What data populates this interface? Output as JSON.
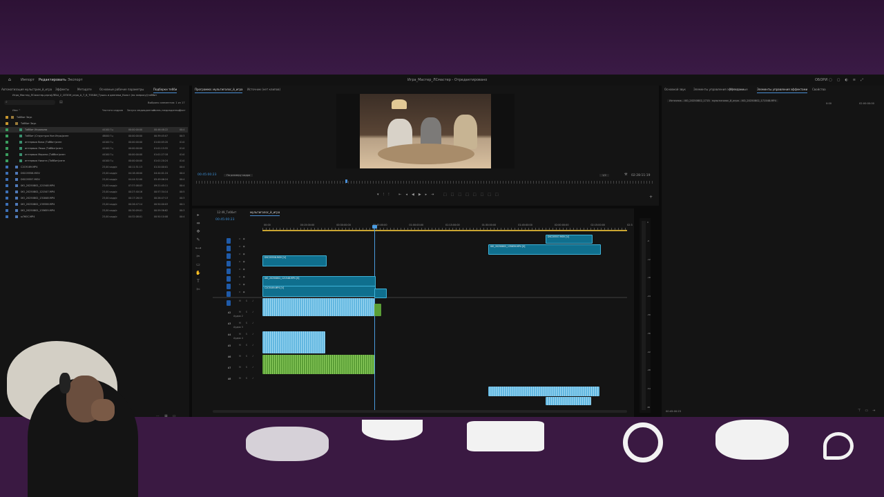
{
  "colors": {
    "accent": "#4a8fd6",
    "video_clip": "#0f6f8e",
    "audio_clip": "#62b7e0",
    "audio_clip_green": "#5a9e36",
    "track_toggle": "#1f5aa8"
  },
  "menubar": {
    "items": [
      "Импорт",
      "Редактировать",
      "Экспорт"
    ],
    "title": "Игра_Мастер_ЛСмастер - Отредактировано",
    "right": "ОБОРИ"
  },
  "project": {
    "tabs": [
      "Автоматизация мульстрим_й_игра",
      "Эффекты",
      "Метадате",
      "Основные рабочие параметры",
      "Подборки тебби"
    ],
    "path": "Игра_Мастер_ЛСмастер.prproj\\ЛЕШ_2_СЕЗОН_игра_А_7_6_ТОББИ_Тушкь и даннеки_Кольт (по запросу)\\тоббит",
    "selected": "Выбрано элементов: 1 из 17",
    "columns": [
      "Имя ^",
      "Частота кадров",
      "Запуск медиаданных",
      "Конец медиаданных",
      "Длит"
    ],
    "rows": [
      {
        "name": "Тоббит Звук",
        "fps": "",
        "start": "",
        "end": "",
        "dur": "",
        "icon": "folder",
        "color": "#c8972e"
      },
      {
        "name": "Тоббит Звук",
        "fps": "",
        "start": "",
        "end": "",
        "dur": "",
        "icon": "folder",
        "color": "#c8972e"
      },
      {
        "name": "Тоббит Игральню",
        "fps": "44100 Гц",
        "start": "00:00:00:00",
        "end": "00:46:48:22",
        "dur": "00:4",
        "icon": "seq",
        "color": "#3a9e5e"
      },
      {
        "name": "Тоббит (Структура Нон Игры)ознн",
        "fps": "48000 Гц",
        "start": "00:00:00:00",
        "end": "00:39:45:07",
        "dur": "00:3",
        "icon": "seq",
        "color": "#3a9e5e"
      },
      {
        "name": "интервью Вика (Тоббит)ознн",
        "fps": "44100 Гц",
        "start": "00:00:00:00",
        "end": "01:00:05:20",
        "dur": "01:0",
        "icon": "seq",
        "color": "#3a9e5e"
      },
      {
        "name": "интервью Леша (Тоббит)ознн",
        "fps": "44100 Гц",
        "start": "00:00:00:00",
        "end": "01:01:15:55",
        "dur": "01:0",
        "icon": "seq",
        "color": "#3a9e5e"
      },
      {
        "name": "интервью Марина (Тоббит)ознн",
        "fps": "44100 Гц",
        "start": "00:00:00:00",
        "end": "01:01:27:18",
        "dur": "01:0",
        "icon": "seq",
        "color": "#3a9e5e"
      },
      {
        "name": "интервью Никита (Тоббит)ознн",
        "fps": "44100 Гц",
        "start": "00:00:00:00",
        "end": "01:01:20:24",
        "dur": "01:0",
        "icon": "seq",
        "color": "#3a9e5e"
      },
      {
        "name": "C2C9169.MP4",
        "fps": "23,00 кадр/с",
        "start": "00:11:51:13",
        "end": "01:20:00:01",
        "dur": "00:4",
        "icon": "clip",
        "color": "#3c6fb5"
      },
      {
        "name": "DSC05558.MOV",
        "fps": "23,00 кадр/с",
        "start": "04:18:48:00",
        "end": "04:44:01:24",
        "dur": "00:4",
        "icon": "clip",
        "color": "#3c6fb5"
      },
      {
        "name": "DSC05557.MOV",
        "fps": "23,00 кадр/с",
        "start": "04:44:52:00",
        "end": "05:49:06:24",
        "dur": "00:4",
        "icon": "clip",
        "color": "#3c6fb5"
      },
      {
        "name": "IXO_20250802_121548.MP4",
        "fps": "23,00 кадр/с",
        "start": "07:37:08:03",
        "end": "09:21:45:11",
        "dur": "00:4",
        "icon": "clip",
        "color": "#3c6fb5"
      },
      {
        "name": "IXO_20250802_121547.MP4",
        "fps": "23,00 кадр/с",
        "start": "00:27:40:16",
        "end": "00:57:34:14",
        "dur": "00:5",
        "icon": "clip",
        "color": "#3c6fb5"
      },
      {
        "name": "IXO_20250802_131848.MP4",
        "fps": "23,00 кадр/с",
        "start": "00:17:26:15",
        "end": "00:26:47:13",
        "dur": "00:3",
        "icon": "clip",
        "color": "#3c6fb5"
      },
      {
        "name": "IXO_20250802_135558.MP4",
        "fps": "23,00 кадр/с",
        "start": "00:26:47:14",
        "end": "00:50:00:03",
        "dur": "00:1",
        "icon": "clip",
        "color": "#3c6fb5"
      },
      {
        "name": "IXO_20250802_135659.MP4",
        "fps": "23,00 кадр/с",
        "start": "00:30:09:01",
        "end": "00:59:56:62",
        "dur": "00:3",
        "icon": "clip",
        "color": "#3c6fb5"
      },
      {
        "name": "ы760C.MP4",
        "fps": "23,00 кадр/с",
        "start": "04:32:08:01",
        "end": "00:50:10:08",
        "dur": "00:4",
        "icon": "clip",
        "color": "#3c6fb5"
      }
    ]
  },
  "program": {
    "tabs": [
      "Программа: мультиголос_й_игра",
      "Источник (нет клипов)"
    ],
    "timecode_left": "00:45:00:23",
    "fit": "По размеру кадра",
    "quality": "1/2",
    "timecode_right": "02:28:11:19"
  },
  "timeline": {
    "tabs": [
      "12:49_Тоббит",
      "мультиголос_й_игра"
    ],
    "timecode": "00:45:00:23",
    "ruler": [
      "00:00",
      "00:15:00:00",
      "00:30:00:00",
      "00:45:00:00",
      "01:00:00:00",
      "01:15:00:00",
      "01:30:00:00",
      "01:45:00:00",
      "02:00:00:00",
      "02:15:00:00",
      "02:3"
    ],
    "video_tracks": [
      "V8",
      "V7",
      "V6",
      "V5",
      "V4",
      "V3",
      "V2",
      "V1"
    ],
    "audio_tracks": [
      {
        "id": "A1",
        "name": ""
      },
      {
        "id": "A2",
        "name": "Аудио 2"
      },
      {
        "id": "A3",
        "name": "Аудио 3"
      },
      {
        "id": "A4",
        "name": "Аудио 4"
      },
      {
        "id": "A5",
        "name": ""
      },
      {
        "id": "A6",
        "name": ""
      },
      {
        "id": "A7",
        "name": ""
      },
      {
        "id": "A8",
        "name": ""
      }
    ],
    "clips": {
      "v8": "DSC05557.MOV [V]",
      "v7": "IXO_20250802_135659.MP4 [V]",
      "v6": "DSC05558.MOV [V]",
      "v3": "IXO_20250802_121548.MP4 [V]",
      "v1": "C2C9169.MP4 [V]"
    }
  },
  "effects": {
    "tabs": [
      "Основной звук",
      "Элементы управления эффектами",
      "Метаданные",
      "Элементы управления эффектами",
      "Свойства"
    ],
    "source": "Источник - IXO_20250802_171548.MP4",
    "sequence": "мультиголос_й_игра - IXO_20250802_171548.MP4",
    "time_start": "0:00",
    "time_end": "02:00:00:00",
    "timecode": "00:45:00:23"
  },
  "vu_scale": [
    "0",
    "-6",
    "-12",
    "-18",
    "-24",
    "-30",
    "-36",
    "-42",
    "-48",
    "-54",
    "dB"
  ]
}
